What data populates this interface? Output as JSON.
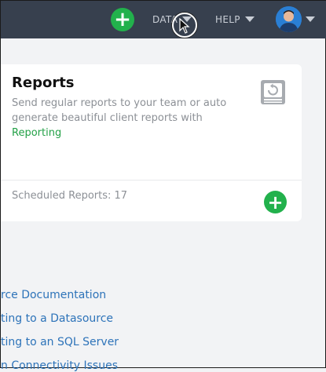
{
  "topbar": {
    "add_icon": "plus-icon",
    "add_symbol": "+",
    "nav_data_label": "DATA",
    "nav_help_label": "HELP",
    "colors": {
      "bar": "#37404e",
      "accent": "#22b14c",
      "nav_text": "#c9ced6"
    }
  },
  "reports_card": {
    "title": "Reports",
    "description": "Send regular reports to your team or auto generate beautiful client reports with",
    "link_label": "Reporting",
    "icon": "report-icon",
    "scheduled_label": "Scheduled Reports: 17",
    "add_symbol": "+",
    "colors": {
      "link": "#22a046",
      "muted": "#8c9096"
    }
  },
  "docs": {
    "links": [
      "rce Documentation",
      "ting to a Datasource",
      "ting to an SQL Server",
      "n Connectivity Issues"
    ],
    "color": "#2d73b9"
  }
}
